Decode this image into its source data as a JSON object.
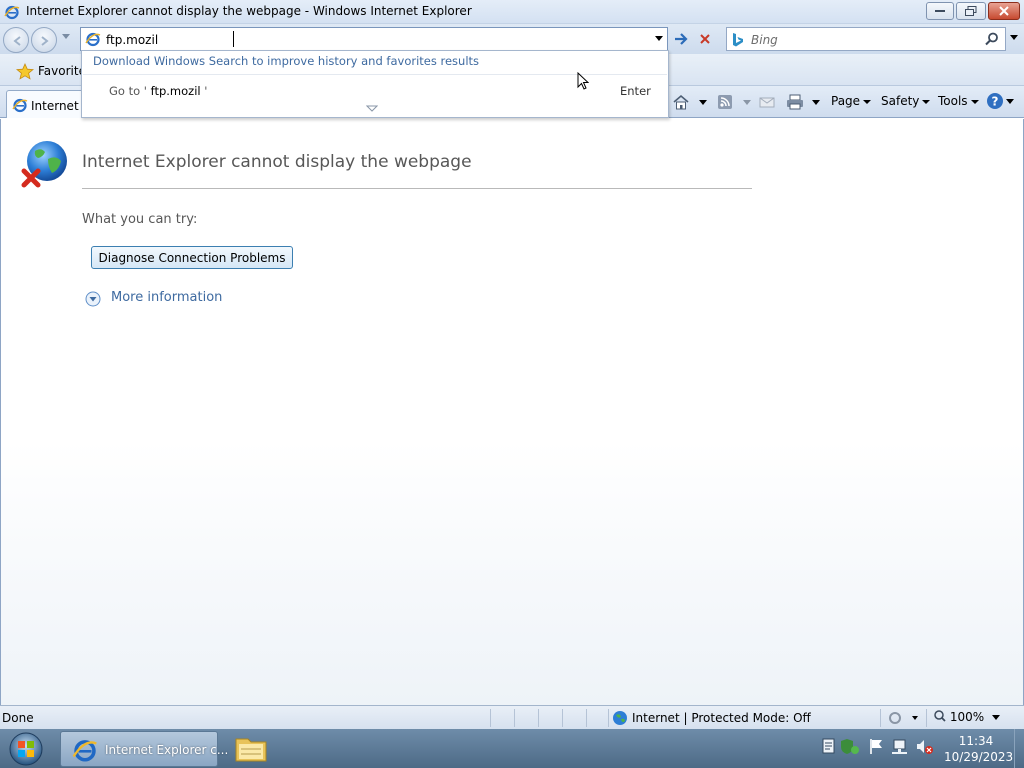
{
  "window": {
    "title": "Internet Explorer cannot display the webpage - Windows Internet Explorer"
  },
  "address_bar": {
    "value": "ftp.mozil"
  },
  "search": {
    "placeholder": "Bing"
  },
  "favorites": {
    "label": "Favorite"
  },
  "tab": {
    "label": "Internet E"
  },
  "commands": {
    "page": "Page",
    "safety": "Safety",
    "tools": "Tools"
  },
  "autocomplete": {
    "download_hint": "Download Windows Search to improve history and favorites results",
    "goto_prefix": "Go to '",
    "goto_value": "ftp.mozil",
    "goto_suffix": "'",
    "enter_label": "Enter"
  },
  "content": {
    "title": "Internet Explorer cannot display the webpage",
    "what_you_can_try": "What you can try:",
    "diagnose_button": "Diagnose Connection Problems",
    "more_info": "More information"
  },
  "status": {
    "text": "Done",
    "zone": "Internet | Protected Mode: Off",
    "zoom": "100%"
  },
  "taskbar": {
    "ie_task_label": "Internet Explorer c...",
    "time": "11:34",
    "date": "10/29/2023"
  },
  "colors": {
    "link_blue": "#3e6aa0",
    "title_gray": "#575757",
    "error_red": "#d42b1e"
  }
}
